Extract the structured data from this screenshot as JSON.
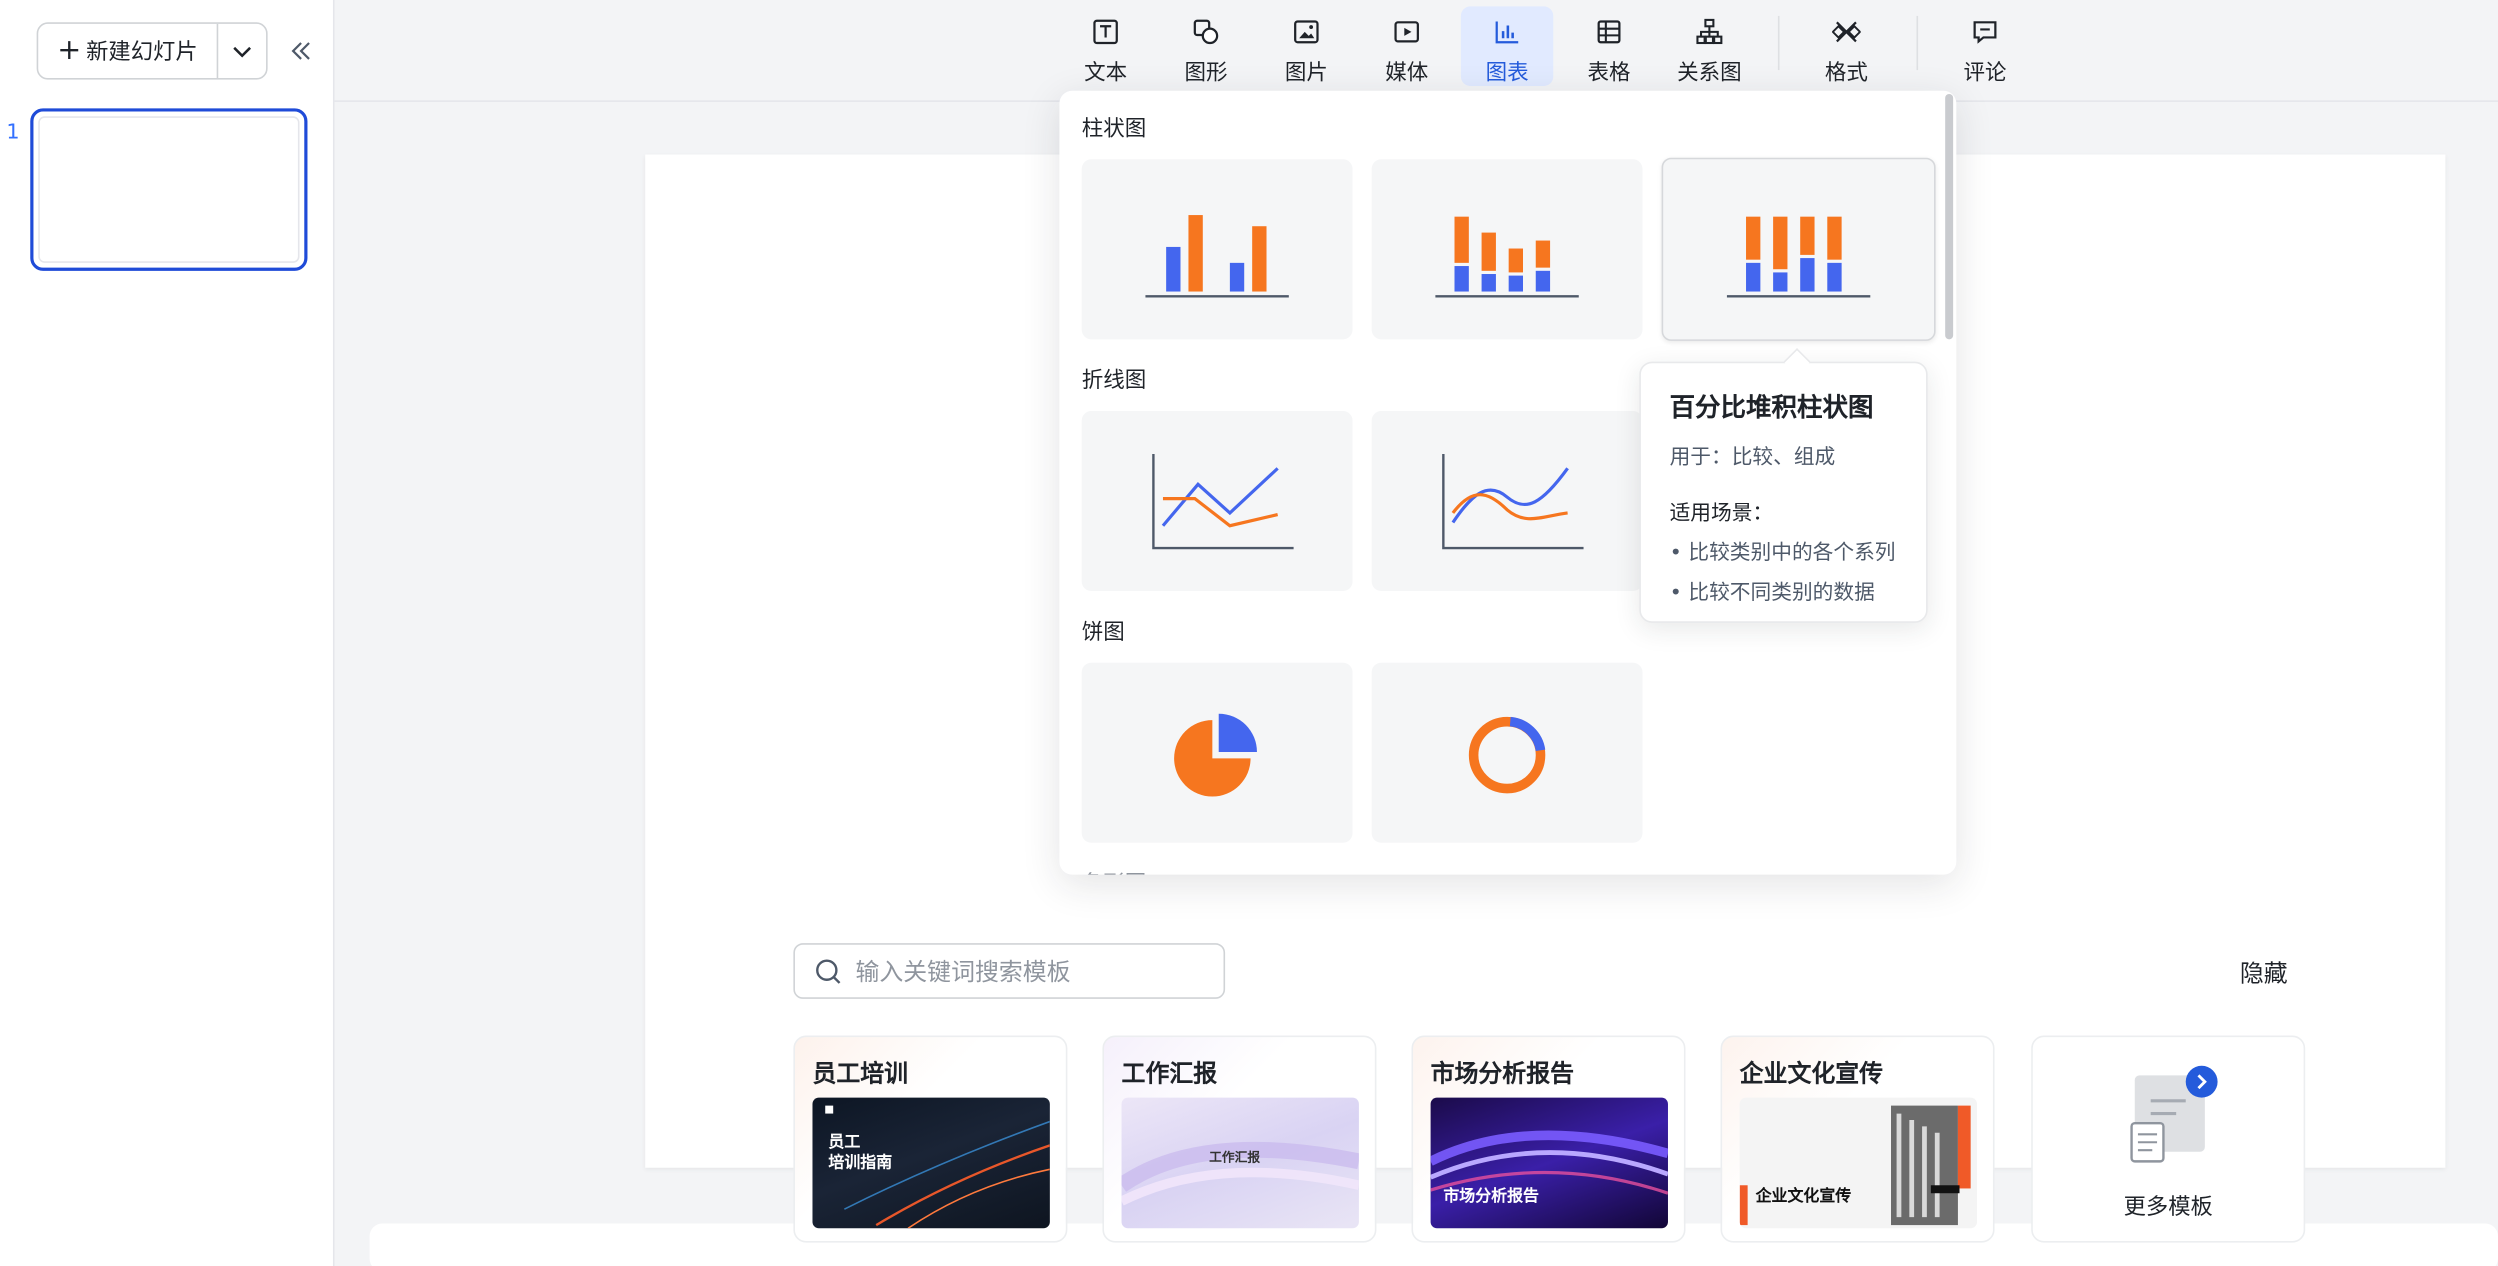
{
  "sidebar": {
    "new_slide_label": "新建幻灯片",
    "slide_number": "1"
  },
  "toolbar": {
    "items": [
      {
        "label": "文本",
        "icon": "text-icon"
      },
      {
        "label": "图形",
        "icon": "shapes-icon"
      },
      {
        "label": "图片",
        "icon": "image-icon"
      },
      {
        "label": "媒体",
        "icon": "media-icon"
      },
      {
        "label": "图表",
        "icon": "chart-icon",
        "active": true
      },
      {
        "label": "表格",
        "icon": "table-icon"
      },
      {
        "label": "关系图",
        "icon": "diagram-icon"
      },
      {
        "label": "格式",
        "icon": "format-icon"
      },
      {
        "label": "评论",
        "icon": "comment-icon"
      }
    ]
  },
  "chart_menu": {
    "sections": [
      {
        "label": "柱状图",
        "options": [
          "clustered-column",
          "stacked-column",
          "percent-stacked-column"
        ]
      },
      {
        "label": "折线图",
        "options": [
          "line",
          "smooth-line"
        ]
      },
      {
        "label": "饼图",
        "options": [
          "pie",
          "donut"
        ]
      }
    ],
    "cutoff_section": "条形图",
    "tooltip": {
      "title": "百分比堆积柱状图",
      "usage": "用于：比较、组成",
      "scene_title": "适用场景：",
      "scene_items": [
        "比较类别中的各个系列",
        "比较不同类别的数据"
      ]
    }
  },
  "colors": {
    "accent": "#3370ff",
    "orange": "#f6761f",
    "blue": "#4466ee",
    "active_bg": "#e1eaff"
  },
  "templates": {
    "search_placeholder": "输入关键词搜索模板",
    "hide_label": "隐藏",
    "items": [
      {
        "title": "员工培训",
        "caption": "员工\n培训指南"
      },
      {
        "title": "工作汇报",
        "caption": "工作汇报"
      },
      {
        "title": "市场分析报告",
        "caption": "市场分析报告"
      },
      {
        "title": "企业文化宣传",
        "caption": "企业文化宣传"
      }
    ],
    "more_label": "更多模板"
  }
}
